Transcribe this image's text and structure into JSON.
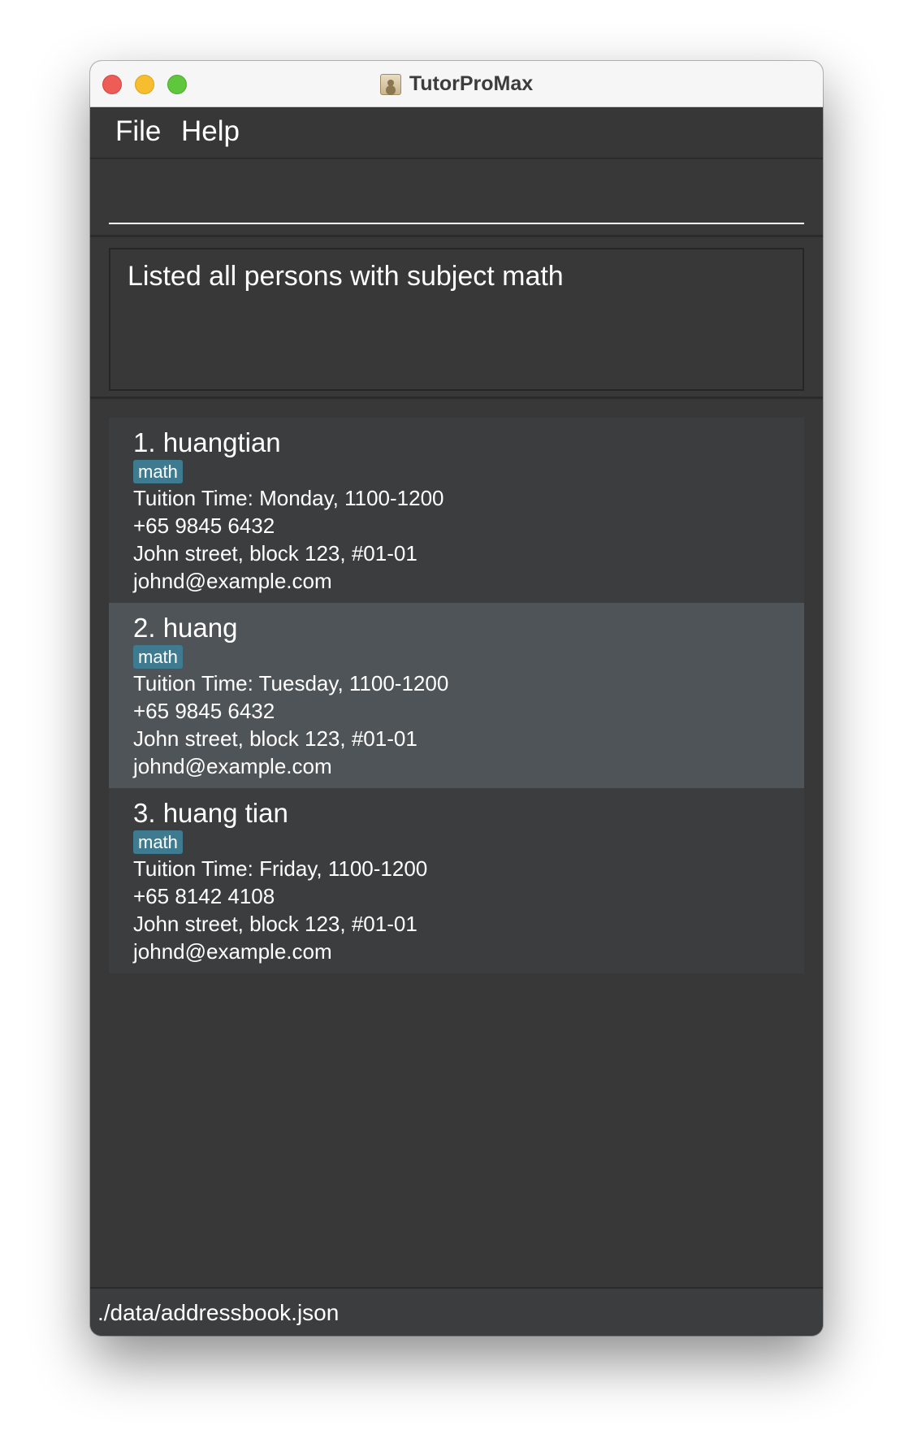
{
  "window": {
    "title": "TutorProMax"
  },
  "menu": {
    "file": "File",
    "help": "Help"
  },
  "command": {
    "value": ""
  },
  "result": {
    "message": "Listed all persons with subject math"
  },
  "persons": [
    {
      "name": "1. huangtian",
      "tag": "math",
      "tuition_time": "Tuition Time: Monday, 1100-1200",
      "phone": "+65 9845 6432",
      "address": "John street, block 123, #01-01",
      "email": "johnd@example.com",
      "selected": false
    },
    {
      "name": "2. huang",
      "tag": "math",
      "tuition_time": "Tuition Time: Tuesday, 1100-1200",
      "phone": "+65 9845 6432",
      "address": "John street, block 123, #01-01",
      "email": "johnd@example.com",
      "selected": true
    },
    {
      "name": "3. huang tian",
      "tag": "math",
      "tuition_time": "Tuition Time: Friday, 1100-1200",
      "phone": "+65 8142 4108",
      "address": "John street, block 123, #01-01",
      "email": "johnd@example.com",
      "selected": false
    }
  ],
  "status": {
    "path": "./data/addressbook.json"
  },
  "colors": {
    "background": "#383838",
    "card": "#3c3d3f",
    "card_selected": "#4f5458",
    "tag": "#3e7b91"
  }
}
